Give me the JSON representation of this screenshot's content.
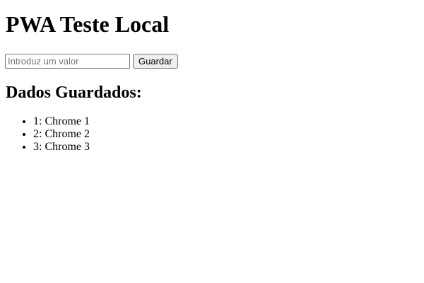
{
  "page": {
    "title": "PWA Teste Local"
  },
  "form": {
    "input_value": "",
    "input_placeholder": "Introduz um valor",
    "save_label": "Guardar"
  },
  "saved_section": {
    "title": "Dados Guardados:",
    "items": [
      {
        "label": "1: Chrome 1"
      },
      {
        "label": "2: Chrome 2"
      },
      {
        "label": "3: Chrome 3"
      }
    ]
  }
}
